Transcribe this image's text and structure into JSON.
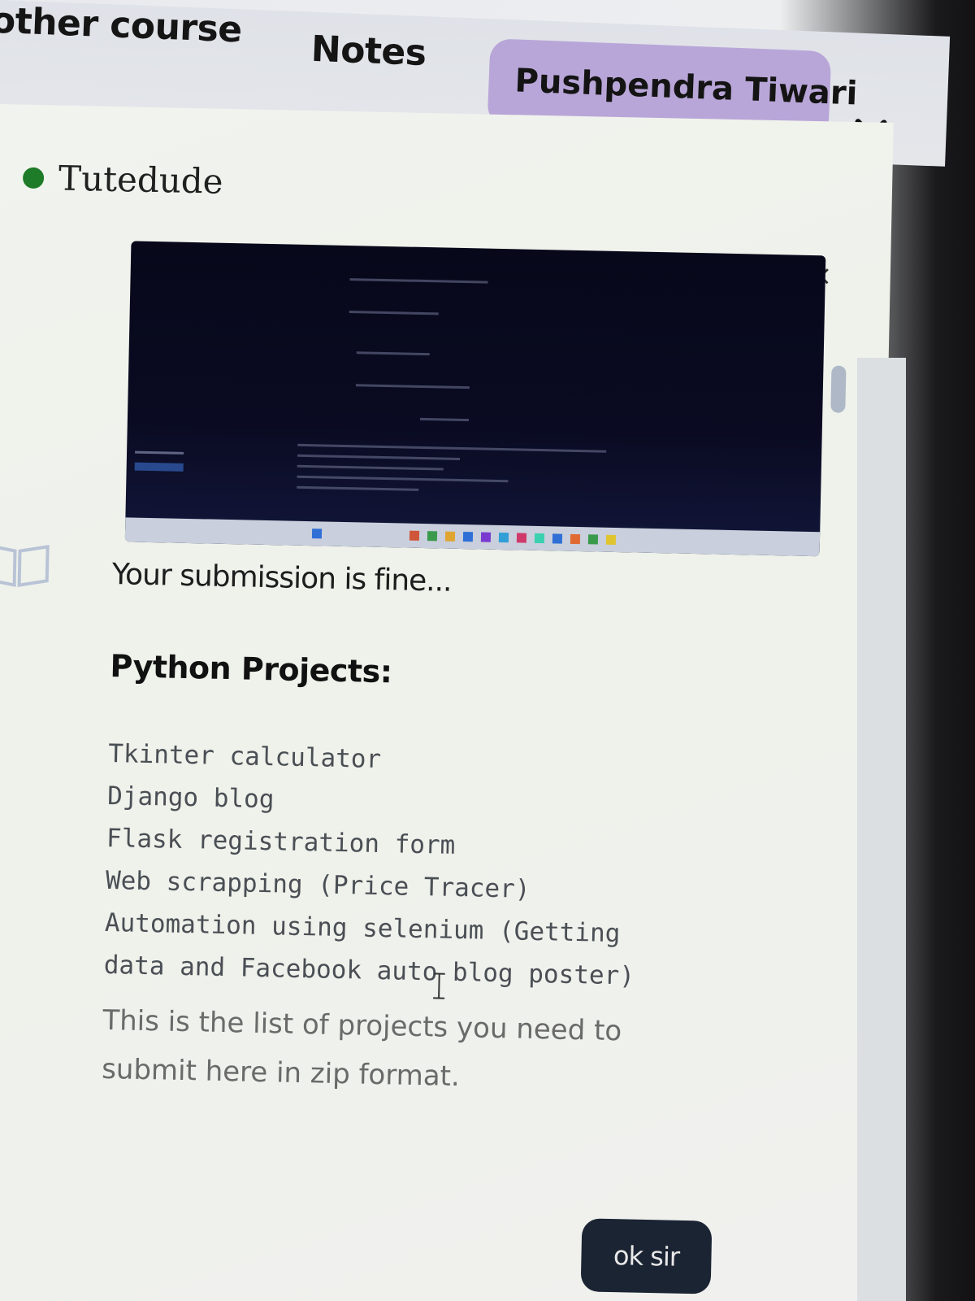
{
  "nav": {
    "other_course": "other course",
    "notes": "Notes",
    "user_name": "Pushpendra Tiwari",
    "chevron_icon": "chevron-down-icon"
  },
  "chat": {
    "title": "Tutedude",
    "status_color": "#1e7b28",
    "close_label": "×",
    "attachment_icon": "screenshot-image",
    "book_icon": "book-icon",
    "message": "Your submission is fine...",
    "heading": "Python Projects:",
    "projects": [
      "Tkinter calculator",
      "Django blog",
      "Flask registration form",
      "Web scrapping (Price Tracer)",
      "Automation using selenium (Getting",
      "data and Facebook auto blog poster)"
    ],
    "instruction": "This is the list of projects you need to submit here in zip format.",
    "reply_button": "ok sir"
  },
  "colors": {
    "user_pill": "#b9a6d8",
    "button_bg": "#1b2433",
    "panel_bg": "#f1f3ee"
  }
}
